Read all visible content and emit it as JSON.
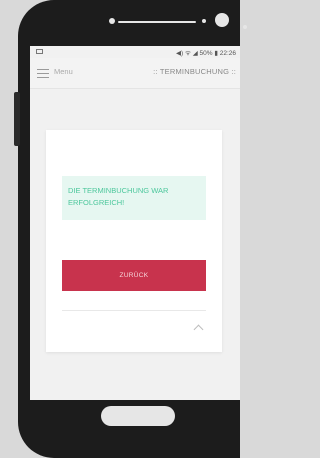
{
  "statusbar": {
    "right_text": "◀) ᯤ ◢ 50% ▮ 22:26"
  },
  "appbar": {
    "menu_label": "Menu",
    "title": ":: TERMINBUCHUNG ::"
  },
  "card": {
    "success_message": "DIE TERMINBUCHUNG WAR ERFOLGREICH!",
    "back_label": "ZURÜCK"
  },
  "colors": {
    "accent": "#c8334d",
    "success_text": "#4cc79c",
    "success_bg": "#e6f7f1"
  }
}
